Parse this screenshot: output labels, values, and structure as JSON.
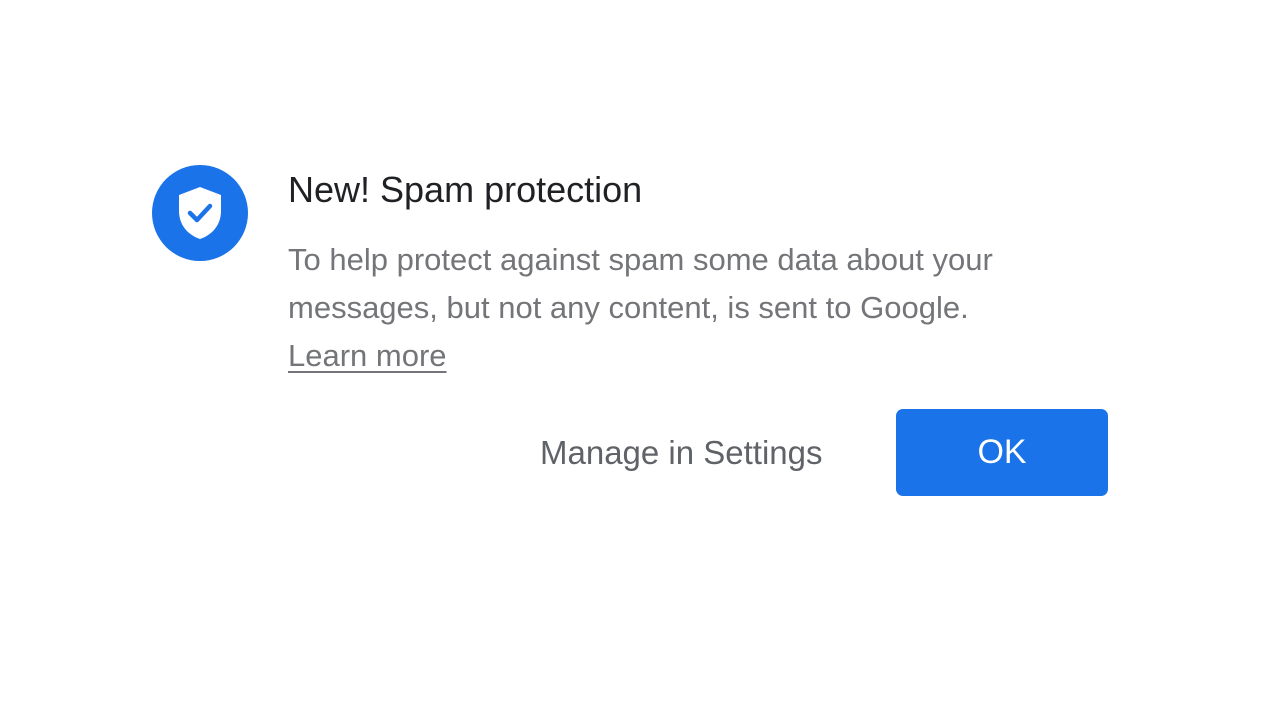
{
  "dialog": {
    "icon": "shield-check-icon",
    "title": "New! Spam protection",
    "body_line1": "To help protect against spam some data about your",
    "body_line2": "messages, but not any content, is sent to Google.",
    "learn_more": "Learn more"
  },
  "actions": {
    "manage_label": "Manage in Settings",
    "ok_label": "OK"
  },
  "colors": {
    "accent": "#1a73e8",
    "title": "#202124",
    "body": "#747579",
    "secondary_button": "#5f6368",
    "background": "#ffffff"
  }
}
